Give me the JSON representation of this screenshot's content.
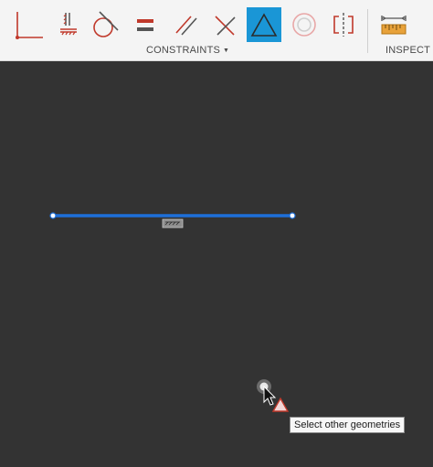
{
  "toolbar": {
    "groups": [
      {
        "label": "CONSTRAINTS"
      },
      {
        "label": "INSPECT"
      }
    ],
    "tools": [
      {
        "icon": "coincident-icon"
      },
      {
        "icon": "horizontal-vertical-icon"
      },
      {
        "icon": "tangent-icon"
      },
      {
        "icon": "equal-icon"
      },
      {
        "icon": "parallel-icon"
      },
      {
        "icon": "perpendicular-icon"
      },
      {
        "icon": "fix-unfix-icon",
        "active": true
      },
      {
        "icon": "concentric-icon"
      },
      {
        "icon": "symmetry-icon"
      },
      {
        "icon": "measure-icon"
      }
    ],
    "active_color": "#1a96d6"
  },
  "canvas": {
    "background": "#333333",
    "line_color": "#1e6fd9"
  },
  "tooltip": {
    "text": "Select other geometries"
  }
}
